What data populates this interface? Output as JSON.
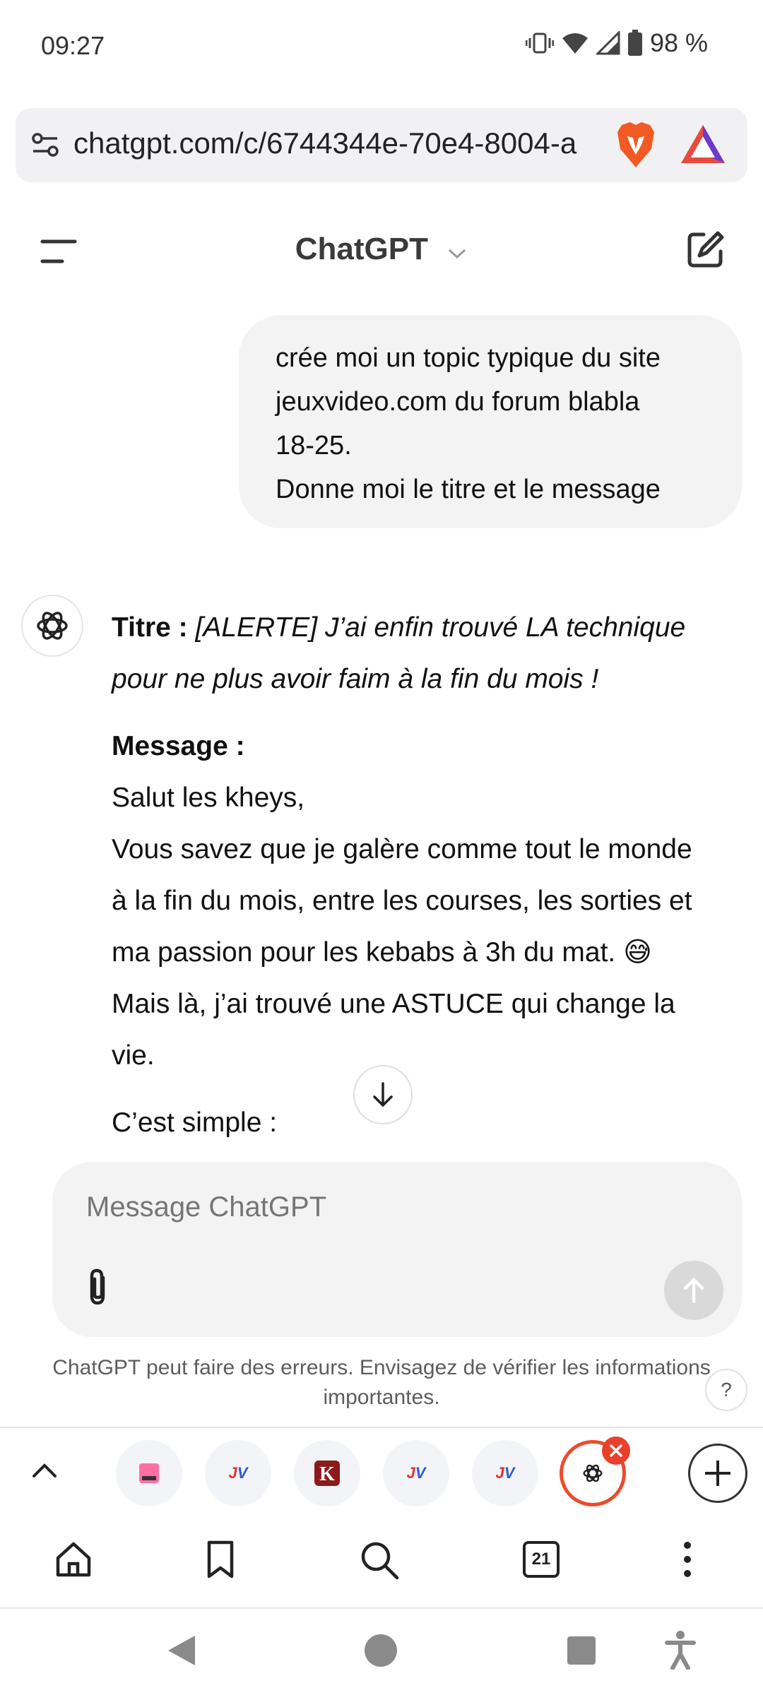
{
  "status_bar": {
    "time": "09:27",
    "battery": "98 %"
  },
  "browser": {
    "url": "chatgpt.com/c/6744344e-70e4-8004-a",
    "icons": [
      "tune-icon",
      "brave-lion-icon",
      "brave-rewards-icon"
    ]
  },
  "header": {
    "title": "ChatGPT"
  },
  "conversation": {
    "user_message": [
      "crée moi un topic typique du site",
      "jeuxvideo.com du forum blabla",
      "18-25.",
      "Donne moi le titre et le message"
    ],
    "assistant": {
      "title_label": "Titre :",
      "title_text_line1": " [ALERTE] J’ai enfin trouvé LA technique",
      "title_text_line2": "pour ne plus avoir faim à la fin du mois !",
      "message_label": "Message :",
      "message_lines": [
        "Salut les kheys,",
        "Vous savez que je galère comme tout le monde",
        "à la fin du mois, entre les courses, les sorties et",
        "ma passion pour les kebabs à 3h du mat. 😅",
        "Mais là, j’ai trouvé une ASTUCE qui change la",
        "vie."
      ],
      "last_line": "C’est simple :"
    }
  },
  "composer": {
    "placeholder": "Message ChatGPT"
  },
  "disclaimer": {
    "line1": "ChatGPT peut faire des erreurs. Envisagez de vérifier les informations",
    "line2": "importantes.",
    "help": "?"
  },
  "tabs": {
    "items": [
      {
        "name": "tab-pink",
        "label": ""
      },
      {
        "name": "tab-jv-1",
        "label": "JV"
      },
      {
        "name": "tab-k",
        "label": "K"
      },
      {
        "name": "tab-jv-2",
        "label": "JV"
      },
      {
        "name": "tab-jv-3",
        "label": "JV"
      },
      {
        "name": "tab-chatgpt",
        "label": ""
      }
    ],
    "colors": {
      "active_ring": "#ec4b2c",
      "jv_red": "#e3342f",
      "jv_blue": "#2a5bd7",
      "k_red": "#8b1a1a"
    }
  },
  "toolbar": {
    "tab_count": "21"
  }
}
